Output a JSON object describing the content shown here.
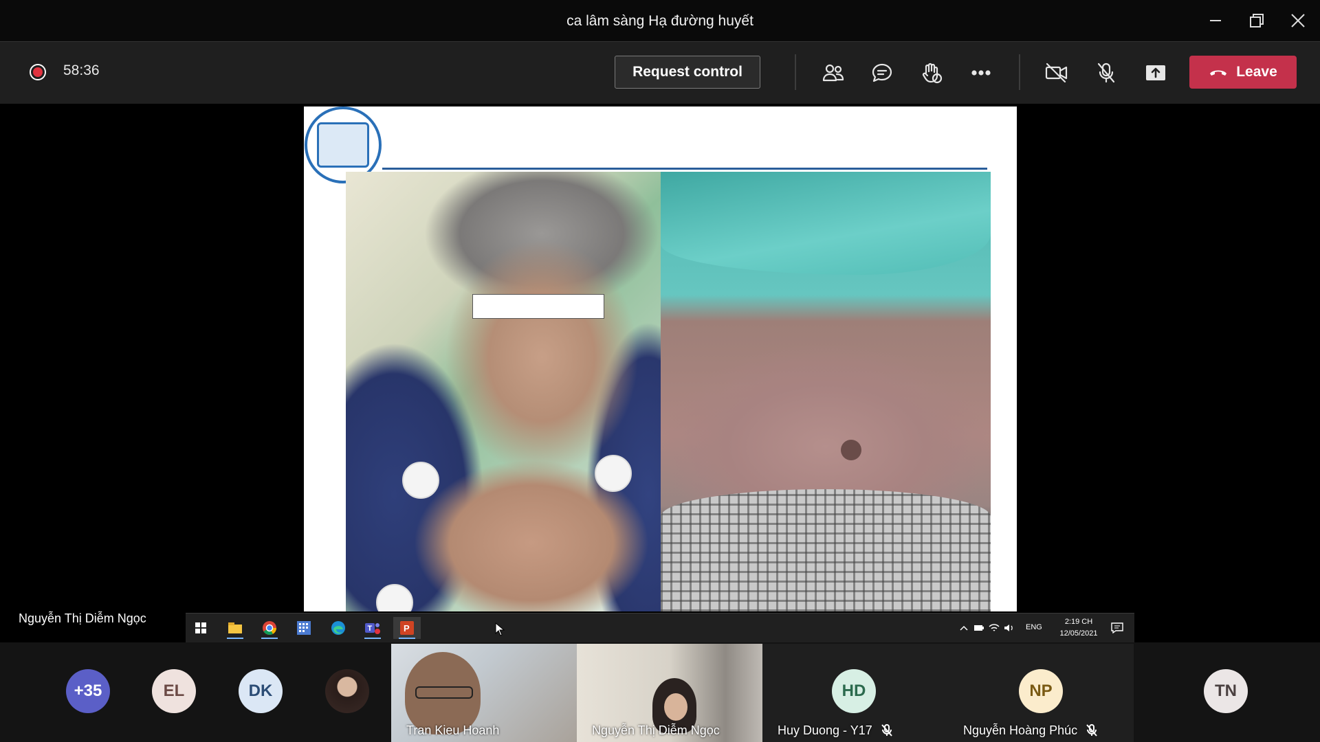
{
  "window": {
    "title": "ca lâm sàng Hạ đường huyết",
    "controls": [
      "minimize-icon",
      "restore-icon",
      "close-icon"
    ]
  },
  "toolbar": {
    "recording_icon": "record-icon",
    "timer": "58:36",
    "request_control_label": "Request control",
    "icons": [
      "people-icon",
      "chat-icon",
      "raise-hand-icon",
      "more-icon",
      "camera-off-icon",
      "mic-off-icon",
      "share-icon"
    ],
    "leave_label": "Leave",
    "leave_color": "#c4314b"
  },
  "presenter": {
    "name": "Nguyễn Thị Diễm Ngọc"
  },
  "taskbar": {
    "apps": [
      "windows-start-icon",
      "file-explorer-icon",
      "chrome-icon",
      "calendar-app-icon",
      "edge-icon",
      "teams-icon",
      "powerpoint-icon"
    ],
    "language": "ENG",
    "time": "2:19 CH",
    "date": "12/05/2021"
  },
  "participants": {
    "overflow_count": "+35",
    "avatars": [
      {
        "initials": "EL",
        "bg": "#efe2de",
        "fg": "#6b4a45"
      },
      {
        "initials": "DK",
        "bg": "#dbe7f5",
        "fg": "#2b4c75"
      }
    ],
    "tiles": [
      {
        "name": "Tran Kieu Hoanh"
      },
      {
        "name": "Nguyễn Thị Diễm Ngọc"
      },
      {
        "name": "Huy Duong - Y17",
        "initials": "HD",
        "bg": "#d7efe4",
        "fg": "#2b6a4d",
        "muted": true
      },
      {
        "name": "Nguyễn Hoàng Phúc",
        "initials": "NP",
        "bg": "#fbeccc",
        "fg": "#7a5a13",
        "muted": true
      }
    ],
    "last_avatar": {
      "initials": "TN",
      "bg": "#ebe6e6",
      "fg": "#4a4040"
    }
  }
}
